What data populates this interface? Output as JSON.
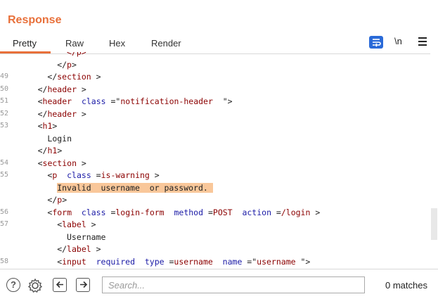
{
  "panel": {
    "title": "Response"
  },
  "tabs": [
    "Pretty",
    "Raw",
    "Hex",
    "Render"
  ],
  "toolbar": {
    "newline_label": "\\n"
  },
  "lines": [
    {
      "num": "",
      "indent": 10,
      "html": "<span class=\"t\">&lt;/p&gt;</span>"
    },
    {
      "num": "",
      "indent": 8,
      "html": "&lt;/<span class=\"t\">p</span>&gt;"
    },
    {
      "num": "49",
      "indent": 6,
      "html": "&lt;/<span class=\"t\">section</span> &gt;"
    },
    {
      "num": "50",
      "indent": 4,
      "html": "&lt;/<span class=\"t\">header</span> &gt;"
    },
    {
      "num": "51",
      "indent": 4,
      "html": "&lt;<span class=\"t\">header</span>  <span class=\"a\">class</span> =\"<span class=\"v\">notification-header</span>  \"&gt;"
    },
    {
      "num": "52",
      "indent": 4,
      "html": "&lt;/<span class=\"t\">header</span> &gt;"
    },
    {
      "num": "53",
      "indent": 4,
      "html": "&lt;<span class=\"t\">h1</span>&gt;"
    },
    {
      "num": "",
      "indent": 6,
      "html": "Login"
    },
    {
      "num": "",
      "indent": 4,
      "html": "&lt;/<span class=\"t\">h1</span>&gt;"
    },
    {
      "num": "54",
      "indent": 4,
      "html": "&lt;<span class=\"t\">section</span> &gt;"
    },
    {
      "num": "55",
      "indent": 6,
      "html": "&lt;<span class=\"t\">p</span>  <span class=\"a\">class</span> =<span class=\"v\">is-warning</span> &gt;"
    },
    {
      "num": "",
      "indent": 8,
      "html": "<span class=\"hl\">Invalid  username  or password. </span>"
    },
    {
      "num": "",
      "indent": 6,
      "html": "&lt;/<span class=\"t\">p</span>&gt;"
    },
    {
      "num": "56",
      "indent": 6,
      "html": "&lt;<span class=\"t\">form</span>  <span class=\"a\">class</span> =<span class=\"v\">login-form</span>  <span class=\"a\">method</span> =<span class=\"v\">POST</span>  <span class=\"a\">action</span> =<span class=\"v\">/login</span> &gt;"
    },
    {
      "num": "57",
      "indent": 8,
      "html": "&lt;<span class=\"t\">label</span> &gt;"
    },
    {
      "num": "",
      "indent": 10,
      "html": "Username"
    },
    {
      "num": "",
      "indent": 8,
      "html": "&lt;/<span class=\"t\">label</span> &gt;"
    },
    {
      "num": "58",
      "indent": 8,
      "html": "&lt;<span class=\"t\">input</span>  <span class=\"a\">required</span>  <span class=\"a\">type</span> =<span class=\"v\">username</span>  <span class=\"a\">name</span> =\"<span class=\"v\">username</span> \"&gt;"
    }
  ],
  "search": {
    "placeholder": "Search..."
  },
  "status": {
    "matches": "0 matches"
  }
}
